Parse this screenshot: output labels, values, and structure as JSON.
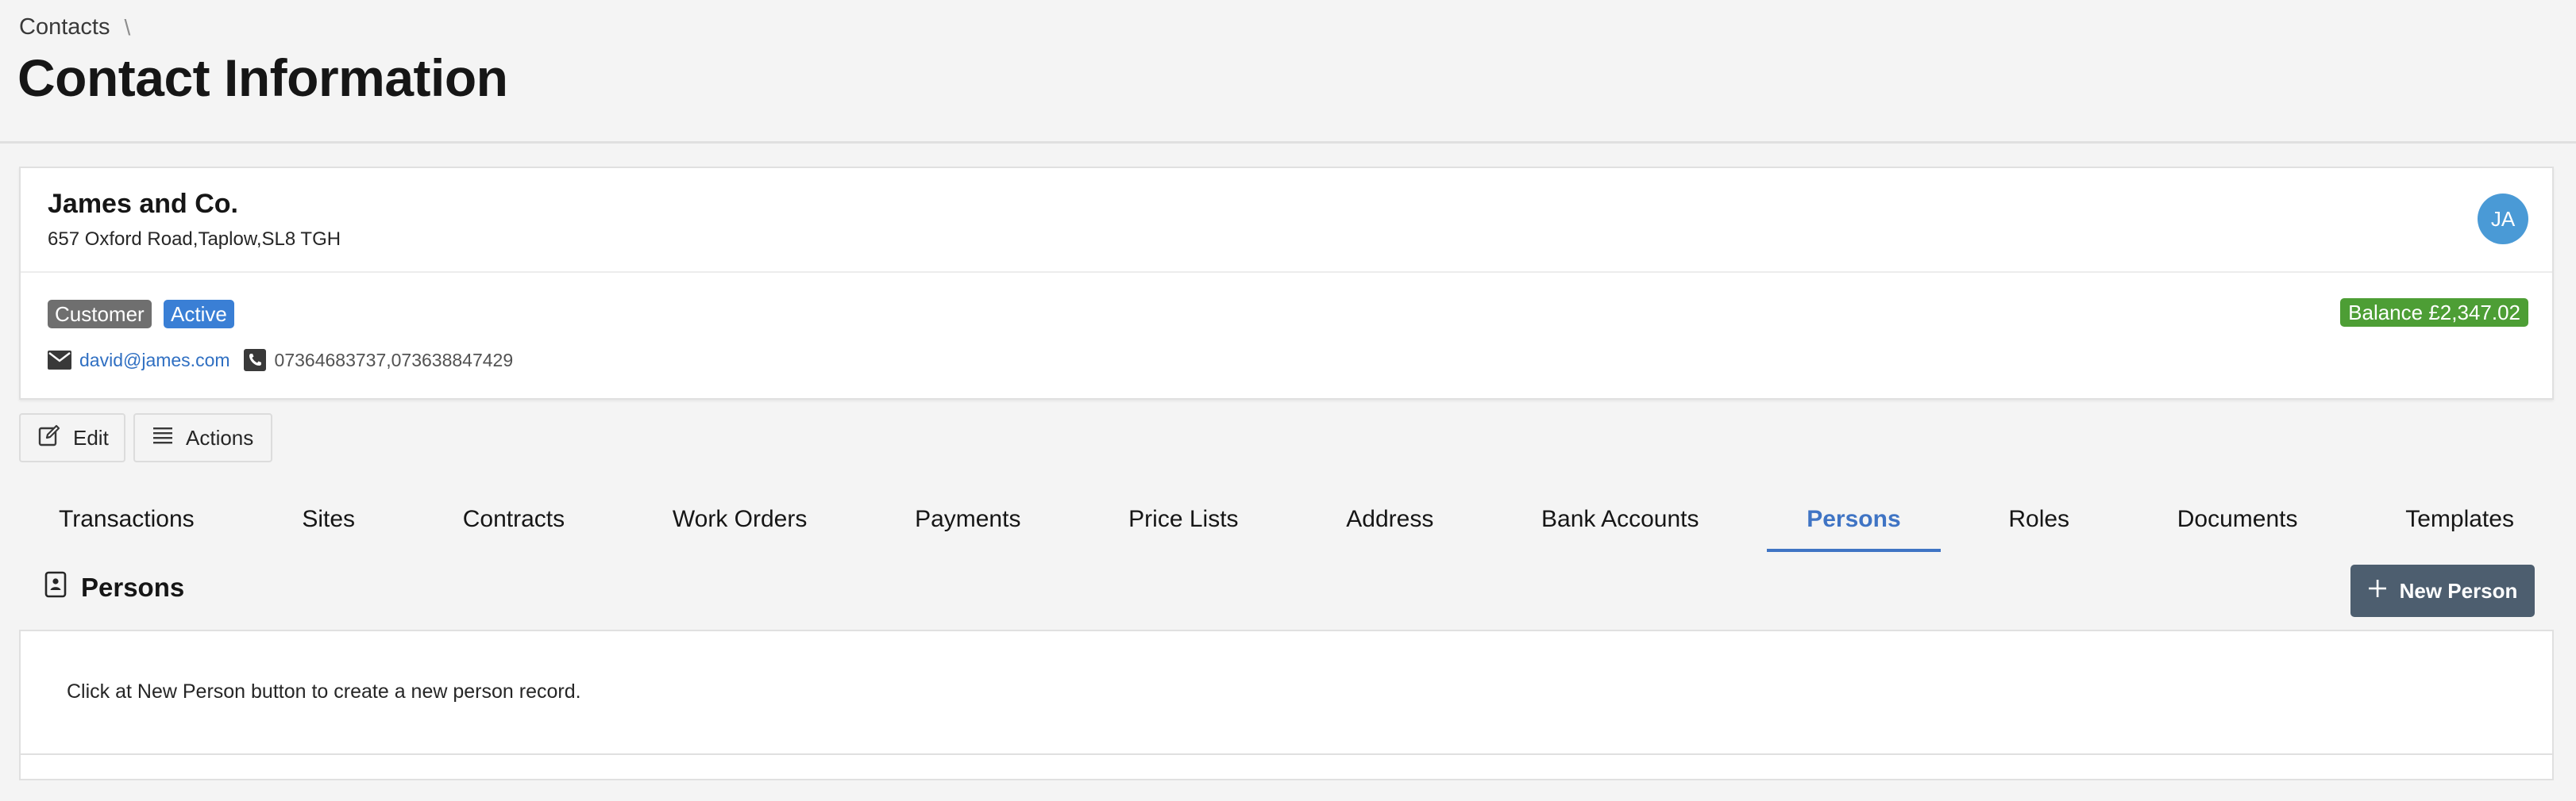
{
  "breadcrumb": {
    "parent": "Contacts",
    "separator": "\\"
  },
  "page": {
    "title": "Contact Information"
  },
  "contact": {
    "name": "James and Co.",
    "address": "657 Oxford Road,Taplow,SL8 TGH",
    "avatar_initials": "JA",
    "tags": {
      "customer": "Customer",
      "active": "Active"
    },
    "balance": "Balance £2,347.02",
    "email": "david@james.com",
    "phones": "07364683737,073638847429"
  },
  "toolbar": {
    "edit_label": "Edit",
    "actions_label": "Actions"
  },
  "tabs": [
    {
      "label": "Transactions"
    },
    {
      "label": "Sites"
    },
    {
      "label": "Contracts"
    },
    {
      "label": "Work Orders"
    },
    {
      "label": "Payments"
    },
    {
      "label": "Price Lists"
    },
    {
      "label": "Address"
    },
    {
      "label": "Bank Accounts"
    },
    {
      "label": "Persons",
      "selected": true
    },
    {
      "label": "Roles"
    },
    {
      "label": "Documents"
    },
    {
      "label": "Templates"
    }
  ],
  "persons_panel": {
    "title": "Persons",
    "new_button_label": "New Person",
    "empty_message": "Click at New Person button to create a new person record."
  },
  "colors": {
    "accent": "#3f74c4",
    "balance": "#4d9e35",
    "active_tag": "#3a7fd5",
    "customer_tag": "#6f6f6f",
    "primary_button": "#4d5e6f"
  },
  "icons": {
    "email": "envelope-icon",
    "phone": "phone-icon",
    "edit": "edit-icon",
    "actions": "list-icon",
    "persons": "contact-card-icon",
    "new": "plus-icon"
  }
}
